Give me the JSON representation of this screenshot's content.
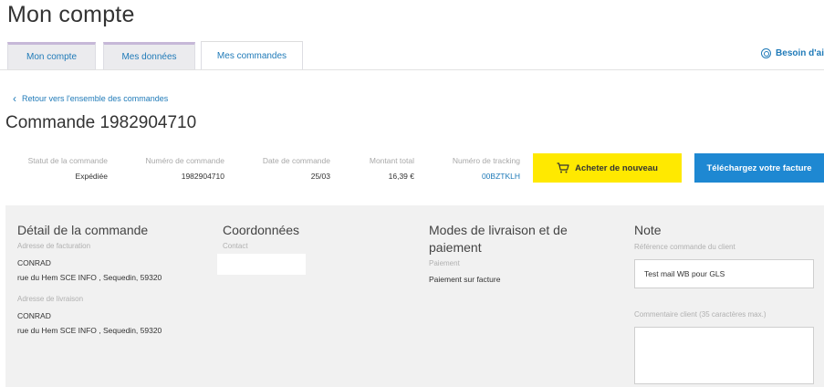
{
  "page_title": "Mon compte",
  "tabs": [
    {
      "label": "Mon compte"
    },
    {
      "label": "Mes données"
    },
    {
      "label": "Mes commandes"
    }
  ],
  "help_label": "Besoin d'ai",
  "back_link": "Retour vers l'ensemble des commandes",
  "order_title": "Commande 1982904710",
  "summary": {
    "status_label": "Statut de la commande",
    "status_value": "Expédiée",
    "number_label": "Numéro de commande",
    "number_value": "1982904710",
    "date_label": "Date de commande",
    "date_value": "25/03",
    "total_label": "Montant total",
    "total_value": "16,39 €",
    "tracking_label": "Numéro de tracking",
    "tracking_value": "00BZTKLH"
  },
  "buttons": {
    "buy_again": "Acheter de nouveau",
    "invoice": "Téléchargez votre facture"
  },
  "details": {
    "order_detail_title": "Détail de la commande",
    "billing_label": "Adresse de facturation",
    "billing_name": "CONRAD",
    "billing_address": "rue du Hem SCE INFO , Sequedin, 59320",
    "shipping_label": "Adresse de livraison",
    "shipping_name": "CONRAD",
    "shipping_address": "rue du Hem SCE INFO , Sequedin, 59320",
    "contact_title": "Coordonnées",
    "contact_label": "Contact",
    "delivery_title_1": "Modes de livraison et de",
    "delivery_title_2": "paiement",
    "payment_label": "Paiement",
    "payment_value": "Paiement sur facture",
    "note_title": "Note",
    "client_ref_label": "Référence commande du client",
    "client_ref_value": "Test mail WB pour GLS",
    "comment_label": "Commentaire client (35 caractères max.)",
    "comment_value": ""
  },
  "colors": {
    "accent_blue": "#1e88d2",
    "link_blue": "#1f7ab8",
    "buy_yellow": "#ffe900"
  }
}
